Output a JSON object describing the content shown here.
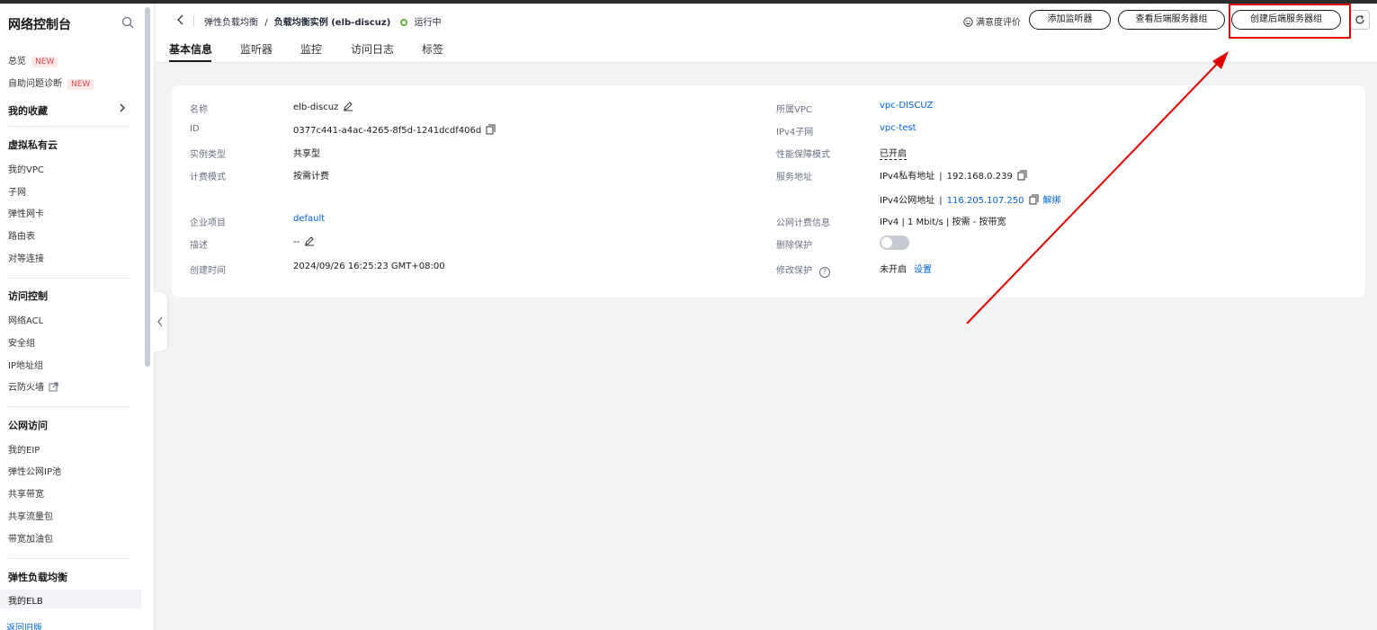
{
  "sidebar": {
    "title": "网络控制台",
    "overview": "总览",
    "overview_badge": "NEW",
    "diagnose": "自助问题诊断",
    "diagnose_badge": "NEW",
    "favorites": "我的收藏",
    "groups": {
      "vpc": "虚拟私有云",
      "access": "访问控制",
      "public": "公网访问",
      "elb": "弹性负载均衡"
    },
    "vpc_items": [
      "我的VPC",
      "子网",
      "弹性网卡",
      "路由表",
      "对等连接"
    ],
    "access_items": [
      "网络ACL",
      "安全组",
      "IP地址组",
      "云防火墙"
    ],
    "public_items": [
      "我的EIP",
      "弹性公网IP池",
      "共享带宽",
      "共享流量包",
      "带宽加油包"
    ],
    "elb_items": [
      "我的ELB"
    ],
    "back_old": "返回旧版"
  },
  "header": {
    "crumb_parent": "弹性负载均衡",
    "crumb_sep": "/",
    "crumb_current": "负载均衡实例 (elb-discuz)",
    "status": "运行中",
    "satisfaction": "满意度评价",
    "btn_add_listener": "添加监听器",
    "btn_view_groups": "查看后端服务器组",
    "btn_create_group": "创建后端服务器组",
    "tabs": [
      "基本信息",
      "监听器",
      "监控",
      "访问日志",
      "标签"
    ]
  },
  "info": {
    "name_label": "名称",
    "name": "elb-discuz",
    "id_label": "ID",
    "id": "0377c441-a4ac-4265-8f5d-1241dcdf406d",
    "type_label": "实例类型",
    "type": "共享型",
    "billing_label": "计费模式",
    "billing": "按需计费",
    "project_label": "企业项目",
    "project": "default",
    "desc_label": "描述",
    "desc": "--",
    "created_label": "创建时间",
    "created": "2024/09/26 16:25:23 GMT+08:00",
    "vpc_label": "所属VPC",
    "vpc": "vpc-DISCUZ",
    "subnet_label": "IPv4子网",
    "subnet": "vpc-test",
    "perf_label": "性能保障模式",
    "perf": "已开启",
    "addr_label": "服务地址",
    "private_prefix": "IPv4私有地址",
    "private_ip": "192.168.0.239",
    "public_prefix": "IPv4公网地址",
    "public_ip": "116.205.107.250",
    "unbind": "解绑",
    "net_label": "公网计费信息",
    "net": "IPv4 | 1 Mbit/s | 按需 - 按带宽",
    "delprot_label": "删除保护",
    "modprot_label": "修改保护",
    "modprot": "未开启",
    "modprot_link": "设置",
    "pipe": "|",
    "help_glyph": "?"
  },
  "colors": {
    "link": "#0062da",
    "status_ok": "#5fb135",
    "highlight": "#e00000"
  }
}
